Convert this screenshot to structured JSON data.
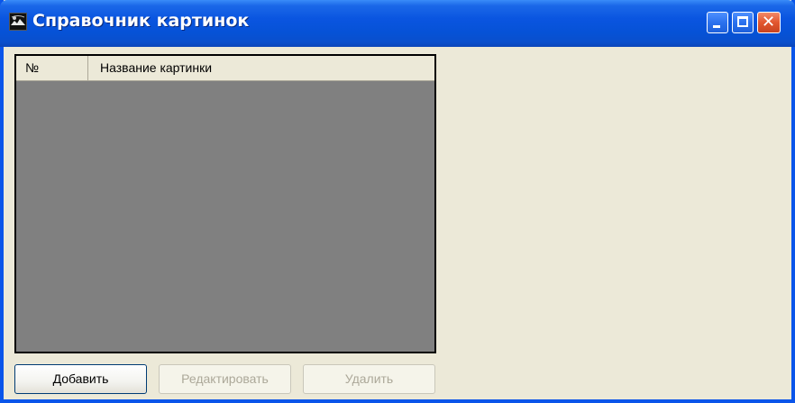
{
  "window": {
    "title": "Справочник картинок",
    "icon": "picture-app-icon"
  },
  "titlebar_buttons": {
    "minimize_icon": "minimize-icon",
    "maximize_icon": "maximize-icon",
    "close_icon": "close-icon"
  },
  "list": {
    "columns": [
      {
        "label": "№"
      },
      {
        "label": "Название картинки"
      }
    ],
    "rows": []
  },
  "buttons": {
    "add": "Добавить",
    "edit": "Редактировать",
    "delete": "Удалить"
  }
}
